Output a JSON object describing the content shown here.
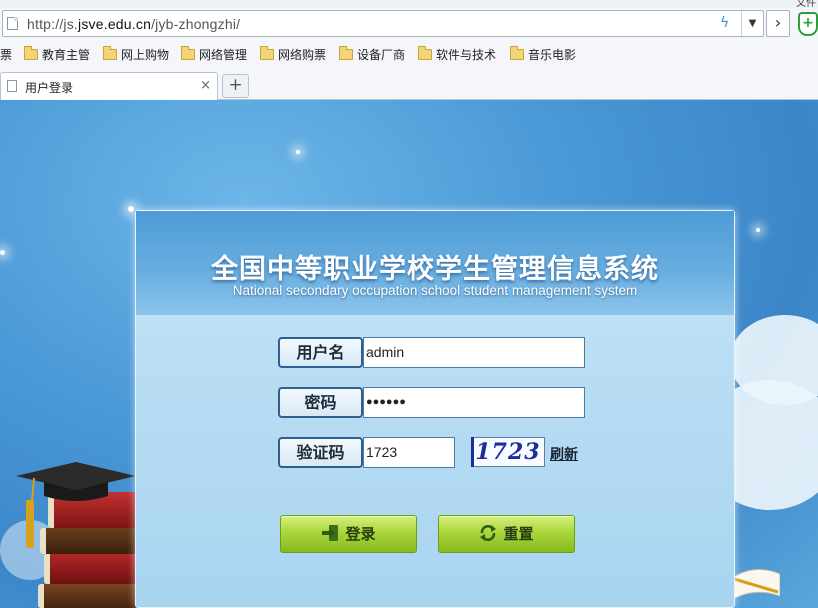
{
  "browser": {
    "top_fragment": "文件",
    "url_prefix": "http://js.",
    "url_domain": "jsve.edu.cn",
    "url_path": "/jyb-zhongzhi/",
    "bookmarks": [
      {
        "label": "票",
        "folder": false
      },
      {
        "label": "教育主管",
        "folder": true
      },
      {
        "label": "网上购物",
        "folder": true
      },
      {
        "label": "网络管理",
        "folder": true
      },
      {
        "label": "网络购票",
        "folder": true
      },
      {
        "label": "设备厂商",
        "folder": true
      },
      {
        "label": "软件与技术",
        "folder": true
      },
      {
        "label": "音乐电影",
        "folder": true
      }
    ],
    "tab": {
      "title": "用户登录",
      "close": "×"
    },
    "new_tab": "+"
  },
  "login": {
    "title": "全国中等职业学校学生管理信息系统",
    "subtitle": "National secondary occupation school student management system",
    "username_label": "用户名",
    "username_value": "admin",
    "password_label": "密码",
    "password_value": "●●●●●●",
    "captcha_label": "验证码",
    "captcha_value": "1723",
    "captcha_image_text": "1723",
    "refresh_label": "刷新",
    "login_button": "登录",
    "reset_button": "重置"
  },
  "colors": {
    "page_background": "#4a98d6",
    "button_green": "#a9d63c",
    "label_border": "#2d5f8f"
  }
}
